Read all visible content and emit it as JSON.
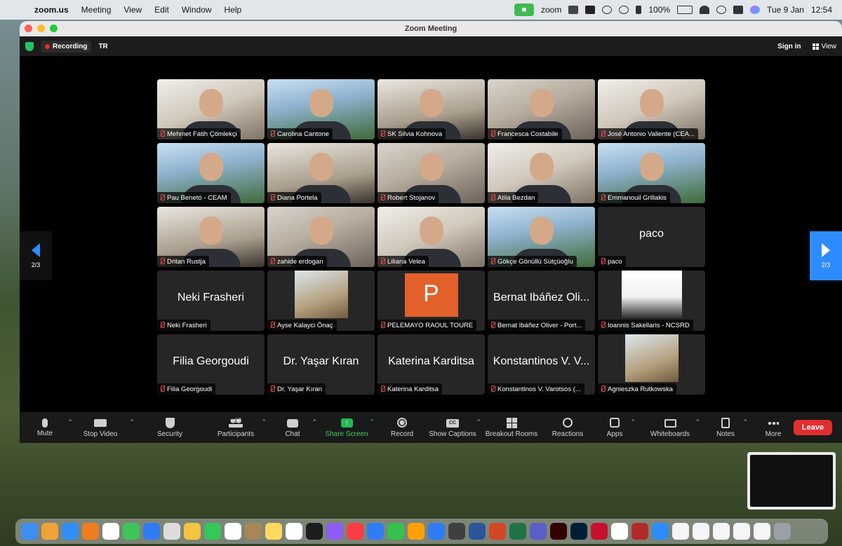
{
  "menubar": {
    "app": "zoom.us",
    "items": [
      "Meeting",
      "View",
      "Edit",
      "Window",
      "Help"
    ],
    "status_app": "zoom",
    "battery": "100%",
    "date": "Tue 9 Jan",
    "time": "12:54"
  },
  "window": {
    "title": "Zoom Meeting",
    "recording_label": "Recording",
    "language": "TR",
    "sign_in": "Sign in",
    "view": "View"
  },
  "page_indicator": "2/3",
  "participants": [
    {
      "name": "Mehmet Fatih Çömlekçi",
      "video": true
    },
    {
      "name": "Carolina Cantone",
      "video": true
    },
    {
      "name": "SK Silvia Kohnova",
      "video": true
    },
    {
      "name": "Francesca Costabile",
      "video": true
    },
    {
      "name": "José Antonio Valiente (CEA...",
      "video": true
    },
    {
      "name": "Pau Benetó - CEAM",
      "video": true
    },
    {
      "name": "Diana Portela",
      "video": true
    },
    {
      "name": "Robert Stojanov",
      "video": true
    },
    {
      "name": "Atila Bezdan",
      "video": true
    },
    {
      "name": "Emmanouil Grillakis",
      "video": true
    },
    {
      "name": "Dritan Rustja",
      "video": true
    },
    {
      "name": "zahide erdogan",
      "video": true
    },
    {
      "name": "Liliana Velea",
      "video": true
    },
    {
      "name": "Gökçe Gönüllü Sütçüoğlu",
      "video": true
    },
    {
      "name": "paco",
      "video": false,
      "display": "paco"
    },
    {
      "name": "Neki Frasheri",
      "video": false,
      "display": "Neki Frasheri"
    },
    {
      "name": "Ayse Kalayci Önaç",
      "video": false,
      "avatar": "photo"
    },
    {
      "name": "PELEMAYO RAOUL TOURE",
      "video": false,
      "avatar": "letter",
      "letter": "P"
    },
    {
      "name": "Bernat Ibáñez Oliver - Port...",
      "video": false,
      "display": "Bernat Ibáñez Oli..."
    },
    {
      "name": "Ioannis Sakellaris - NCSRD",
      "video": false,
      "avatar": "photo-white"
    },
    {
      "name": "Filia Georgoudi",
      "video": false,
      "display": "Filia Georgoudi"
    },
    {
      "name": "Dr. Yaşar Kıran",
      "video": false,
      "display": "Dr. Yaşar Kıran"
    },
    {
      "name": "Katerina Karditsa",
      "video": false,
      "display": "Katerina Karditsa"
    },
    {
      "name": "Konstantinos V. Varotsos (...",
      "video": false,
      "display": "Konstantinos V. V..."
    },
    {
      "name": "Agnieszka Rutkowska",
      "video": false,
      "avatar": "photo"
    }
  ],
  "toolbar": {
    "mute": "Mute",
    "stop_video": "Stop Video",
    "security": "Security",
    "participants": "Participants",
    "participant_count": "68",
    "chat": "Chat",
    "share_screen": "Share Screen",
    "record": "Record",
    "show_captions": "Show Captions",
    "cc": "CC",
    "breakout_rooms": "Breakout Rooms",
    "reactions": "Reactions",
    "apps": "Apps",
    "whiteboards": "Whiteboards",
    "notes": "Notes",
    "more": "More",
    "leave": "Leave"
  },
  "dock_colors": [
    "#3d8ef0",
    "#f0a23a",
    "#2f8ef7",
    "#ef7d1f",
    "#ffffff",
    "#3dc55a",
    "#2e7cf6",
    "#dcdcdc",
    "#f4c342",
    "#34c759",
    "#ffffff",
    "#a88657",
    "#ffd95e",
    "#ffffff",
    "#1d1d1f",
    "#8e5cf7",
    "#fc3c44",
    "#2e7cf6",
    "#33c24d",
    "#ff9f0a",
    "#2e7cf6",
    "#3f3f3f",
    "#2b579a",
    "#d24726",
    "#217346",
    "#5b5fc7",
    "#330000",
    "#001e36",
    "#c8102e",
    "#ffffff",
    "#b32a2a",
    "#2d8cff",
    "#f5f5f5",
    "#f5f5f5",
    "#f5f5f5",
    "#f5f5f5",
    "#f5f5f5",
    "#9aa0a6"
  ]
}
